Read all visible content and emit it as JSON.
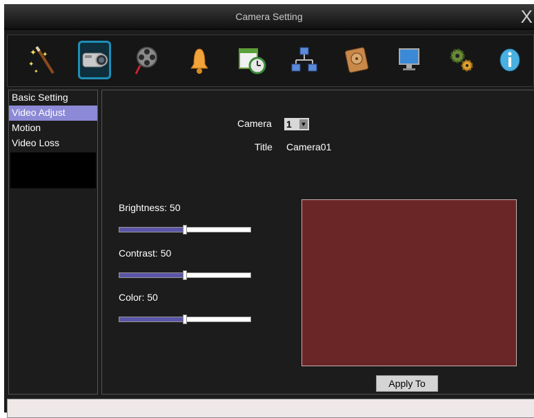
{
  "window": {
    "title": "Camera Setting",
    "close_label": "X"
  },
  "toolbar": {
    "icons": [
      {
        "name": "magic-wand-icon"
      },
      {
        "name": "camera-icon",
        "selected": true
      },
      {
        "name": "film-reel-icon"
      },
      {
        "name": "alarm-bell-icon"
      },
      {
        "name": "schedule-clock-icon"
      },
      {
        "name": "network-icon"
      },
      {
        "name": "storage-disk-icon"
      },
      {
        "name": "monitor-icon"
      },
      {
        "name": "settings-gears-icon"
      },
      {
        "name": "info-icon"
      }
    ]
  },
  "menu": {
    "items": [
      {
        "label": "Basic Setting",
        "selected": false
      },
      {
        "label": "Video Adjust",
        "selected": true
      },
      {
        "label": "Motion",
        "selected": false
      },
      {
        "label": "Video Loss",
        "selected": false
      }
    ]
  },
  "form": {
    "camera_label": "Camera",
    "camera_value": "1",
    "title_label": "Title",
    "title_value": "Camera01"
  },
  "sliders": [
    {
      "label": "Brightness: 50",
      "value": 50,
      "max": 100
    },
    {
      "label": "Contrast: 50",
      "value": 50,
      "max": 100
    },
    {
      "label": "Color: 50",
      "value": 50,
      "max": 100
    }
  ],
  "apply_label": "Apply To",
  "colors": {
    "accent": "#8c89d6",
    "slider_fill": "#5b55a8",
    "preview": "#6a2626",
    "toolbar_selected_border": "#1e8fb8"
  }
}
